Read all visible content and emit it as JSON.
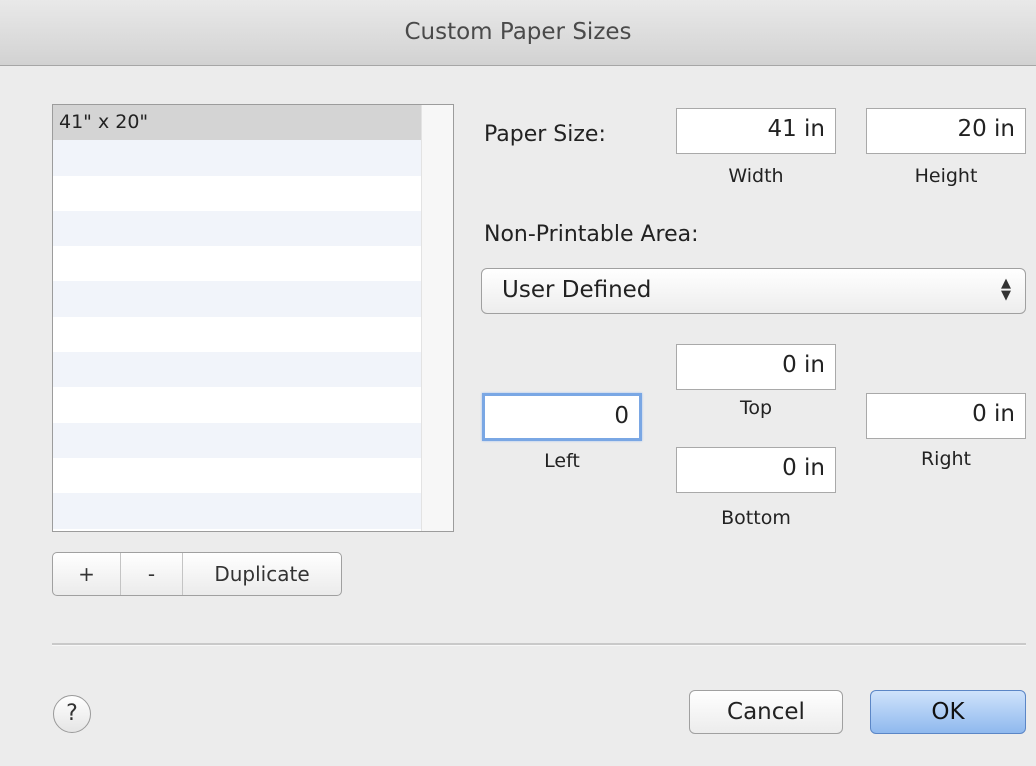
{
  "window": {
    "title": "Custom Paper Sizes"
  },
  "list": {
    "items": [
      {
        "label": "41\" x 20\"",
        "selected": true
      },
      {
        "label": ""
      },
      {
        "label": ""
      },
      {
        "label": ""
      },
      {
        "label": ""
      },
      {
        "label": ""
      },
      {
        "label": ""
      },
      {
        "label": ""
      },
      {
        "label": ""
      },
      {
        "label": ""
      },
      {
        "label": ""
      },
      {
        "label": ""
      }
    ]
  },
  "list_buttons": {
    "add": "+",
    "remove": "-",
    "duplicate": "Duplicate"
  },
  "paper_size": {
    "label": "Paper Size:",
    "width_value": "41  in",
    "width_label": "Width",
    "height_value": "20  in",
    "height_label": "Height"
  },
  "non_printable": {
    "label": "Non-Printable Area:",
    "selected": "User Defined",
    "top_value": "0  in",
    "top_label": "Top",
    "left_value": "0",
    "left_label": "Left",
    "right_value": "0  in",
    "right_label": "Right",
    "bottom_value": "0  in",
    "bottom_label": "Bottom"
  },
  "footer": {
    "help": "?",
    "cancel": "Cancel",
    "ok": "OK"
  },
  "colors": {
    "focus_ring": "#7aa7e4",
    "default_button": "#8fb9ee"
  }
}
